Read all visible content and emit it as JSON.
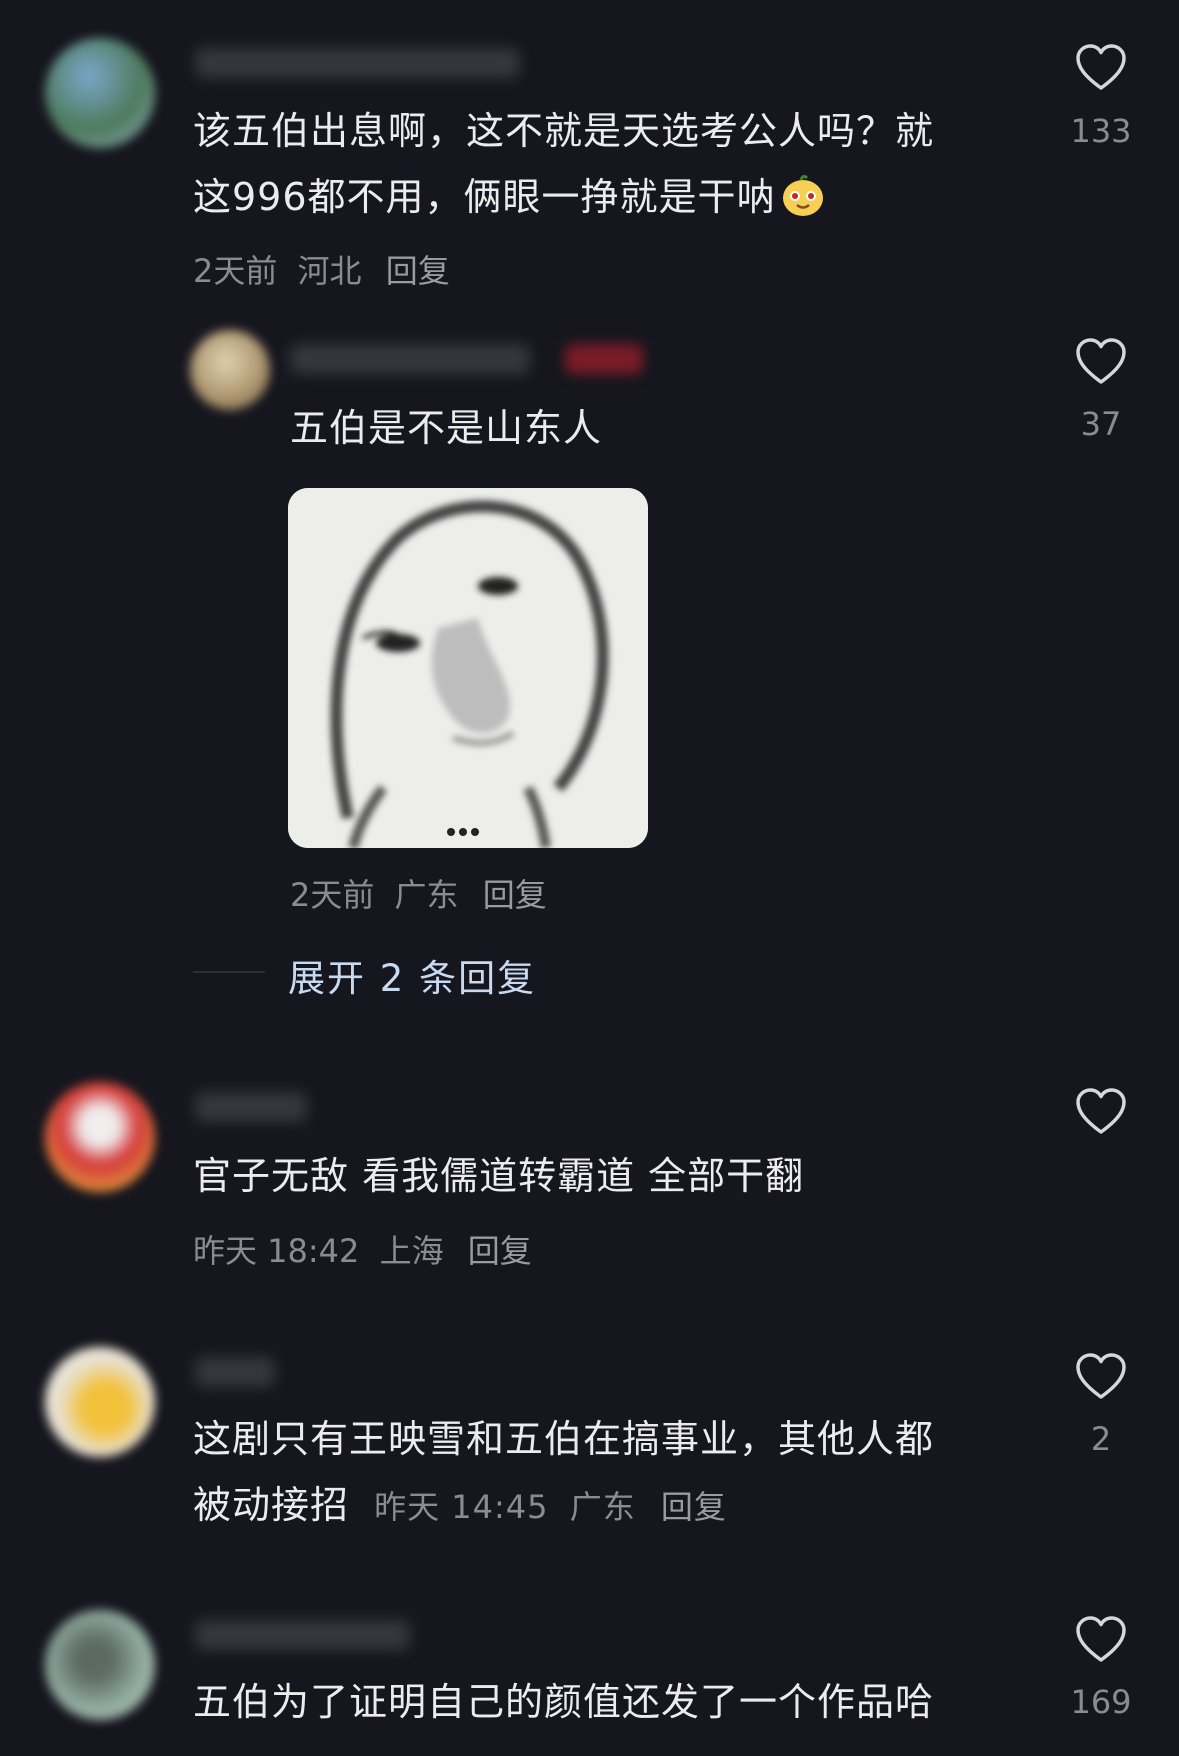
{
  "comments": [
    {
      "text_lines": [
        "该五伯出息啊，这不就是天选考公人吗？就",
        "这996都不用，俩眼一挣就是干呐"
      ],
      "time": "2天前",
      "location": "河北",
      "reply_label": "回复",
      "likes": "133"
    },
    {
      "text": "五伯是不是山东人",
      "time": "2天前",
      "location": "广东",
      "reply_label": "回复",
      "likes": "37"
    },
    {
      "text": "官子无敌 看我儒道转霸道 全部干翻",
      "time": "昨天 18:42",
      "location": "上海",
      "reply_label": "回复",
      "likes": ""
    },
    {
      "text_lines": [
        "这剧只有王映雪和五伯在搞事业，其他人都",
        "被动接招"
      ],
      "time": "昨天 14:45",
      "location": "广东",
      "reply_label": "回复",
      "likes": "2"
    },
    {
      "text": "五伯为了证明自己的颜值还发了一个作品哈",
      "likes": "169"
    }
  ],
  "expand_replies": "展开 2 条回复",
  "icons": {
    "like": "heart-outline-icon",
    "emoji": "smiling-face-emoji-icon"
  },
  "colors": {
    "background": "#16161e",
    "text": "#ececef",
    "meta": "#8b8b94",
    "expand": "#c8daf2"
  }
}
